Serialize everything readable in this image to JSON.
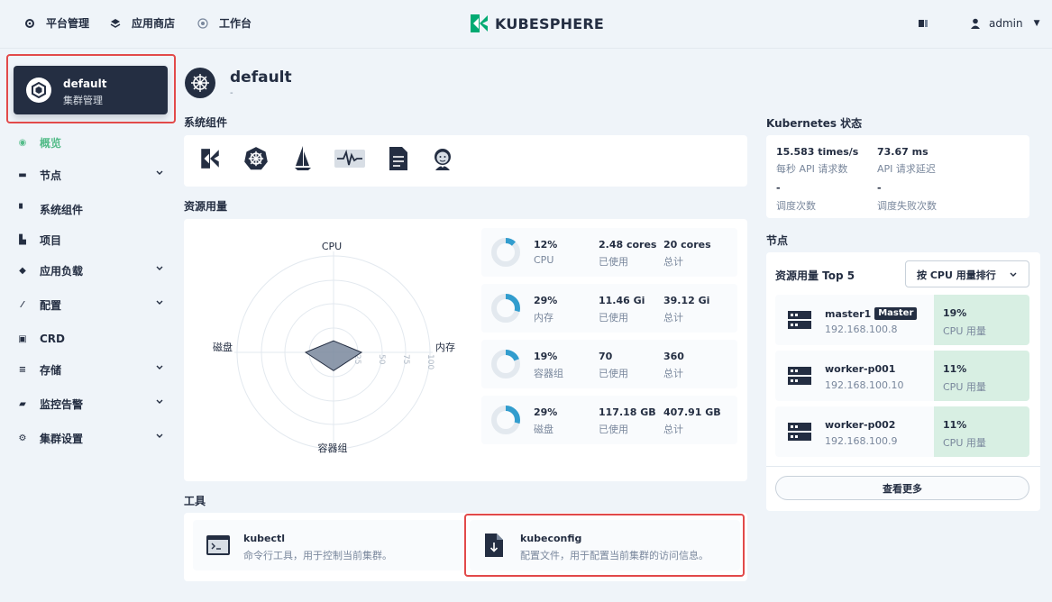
{
  "topnav": {
    "platform": "平台管理",
    "appstore": "应用商店",
    "workbench": "工作台",
    "brand": "KUBESPHERE",
    "user": "admin"
  },
  "sidebar": {
    "cluster_name": "default",
    "cluster_sub": "集群管理",
    "items": [
      {
        "label": "概览",
        "icon": "overview-icon",
        "active": true
      },
      {
        "label": "节点",
        "icon": "nodes-icon",
        "expandable": true
      },
      {
        "label": "系统组件",
        "icon": "components-icon"
      },
      {
        "label": "项目",
        "icon": "projects-icon"
      },
      {
        "label": "应用负载",
        "icon": "workloads-icon",
        "expandable": true
      },
      {
        "label": "配置",
        "icon": "config-icon",
        "expandable": true
      },
      {
        "label": "CRD",
        "icon": "crd-icon"
      },
      {
        "label": "存储",
        "icon": "storage-icon",
        "expandable": true
      },
      {
        "label": "监控告警",
        "icon": "monitoring-icon",
        "expandable": true
      },
      {
        "label": "集群设置",
        "icon": "settings-icon",
        "expandable": true
      }
    ]
  },
  "header": {
    "title": "default",
    "subtitle": "-"
  },
  "system_components": {
    "title": "系统组件",
    "icons": [
      "kubesphere-icon",
      "kubernetes-icon",
      "istio-icon",
      "monitoring-icon",
      "logging-icon",
      "devops-jenkins-icon"
    ]
  },
  "resource_usage": {
    "title": "资源用量",
    "radar_labels": {
      "top": "CPU",
      "right": "内存",
      "bottom": "容器组",
      "left": "磁盘"
    },
    "radar_ticks": [
      "25",
      "50",
      "75",
      "100"
    ],
    "stats": [
      {
        "pct": "12%",
        "name": "CPU",
        "used": "2.48 cores",
        "used_label": "已使用",
        "total": "20 cores",
        "total_label": "总计",
        "value": 0.12
      },
      {
        "pct": "29%",
        "name": "内存",
        "used": "11.46 Gi",
        "used_label": "已使用",
        "total": "39.12 Gi",
        "total_label": "总计",
        "value": 0.29
      },
      {
        "pct": "19%",
        "name": "容器组",
        "used": "70",
        "used_label": "已使用",
        "total": "360",
        "total_label": "总计",
        "value": 0.19
      },
      {
        "pct": "29%",
        "name": "磁盘",
        "used": "117.18 GB",
        "used_label": "已使用",
        "total": "407.91 GB",
        "total_label": "总计",
        "value": 0.29
      }
    ]
  },
  "tools": {
    "title": "工具",
    "items": [
      {
        "name": "kubectl",
        "desc": "命令行工具，用于控制当前集群。"
      },
      {
        "name": "kubeconfig",
        "desc": "配置文件，用于配置当前集群的访问信息。"
      }
    ]
  },
  "k8s_status": {
    "title": "Kubernetes 状态",
    "api_rate": "15.583 times/s",
    "api_rate_label": "每秒 API 请求数",
    "api_latency": "73.67 ms",
    "api_latency_label": "API 请求延迟",
    "sched": "-",
    "sched_label": "调度次数",
    "sched_fail": "-",
    "sched_fail_label": "调度失败次数"
  },
  "nodes": {
    "title": "节点",
    "top_title": "资源用量 Top 5",
    "sort_select": "按 CPU 用量排行",
    "items": [
      {
        "name": "master1",
        "badge": "Master",
        "ip": "192.168.100.8",
        "pct": "19%",
        "pct_label": "CPU 用量"
      },
      {
        "name": "worker-p001",
        "badge": "",
        "ip": "192.168.100.10",
        "pct": "11%",
        "pct_label": "CPU 用量"
      },
      {
        "name": "worker-p002",
        "badge": "",
        "ip": "192.168.100.9",
        "pct": "11%",
        "pct_label": "CPU 用量"
      }
    ],
    "more": "查看更多"
  },
  "colors": {
    "accent": "#55bc8a",
    "blue": "#329dce",
    "highlight": "#e24a4a",
    "dark": "#242e42"
  }
}
